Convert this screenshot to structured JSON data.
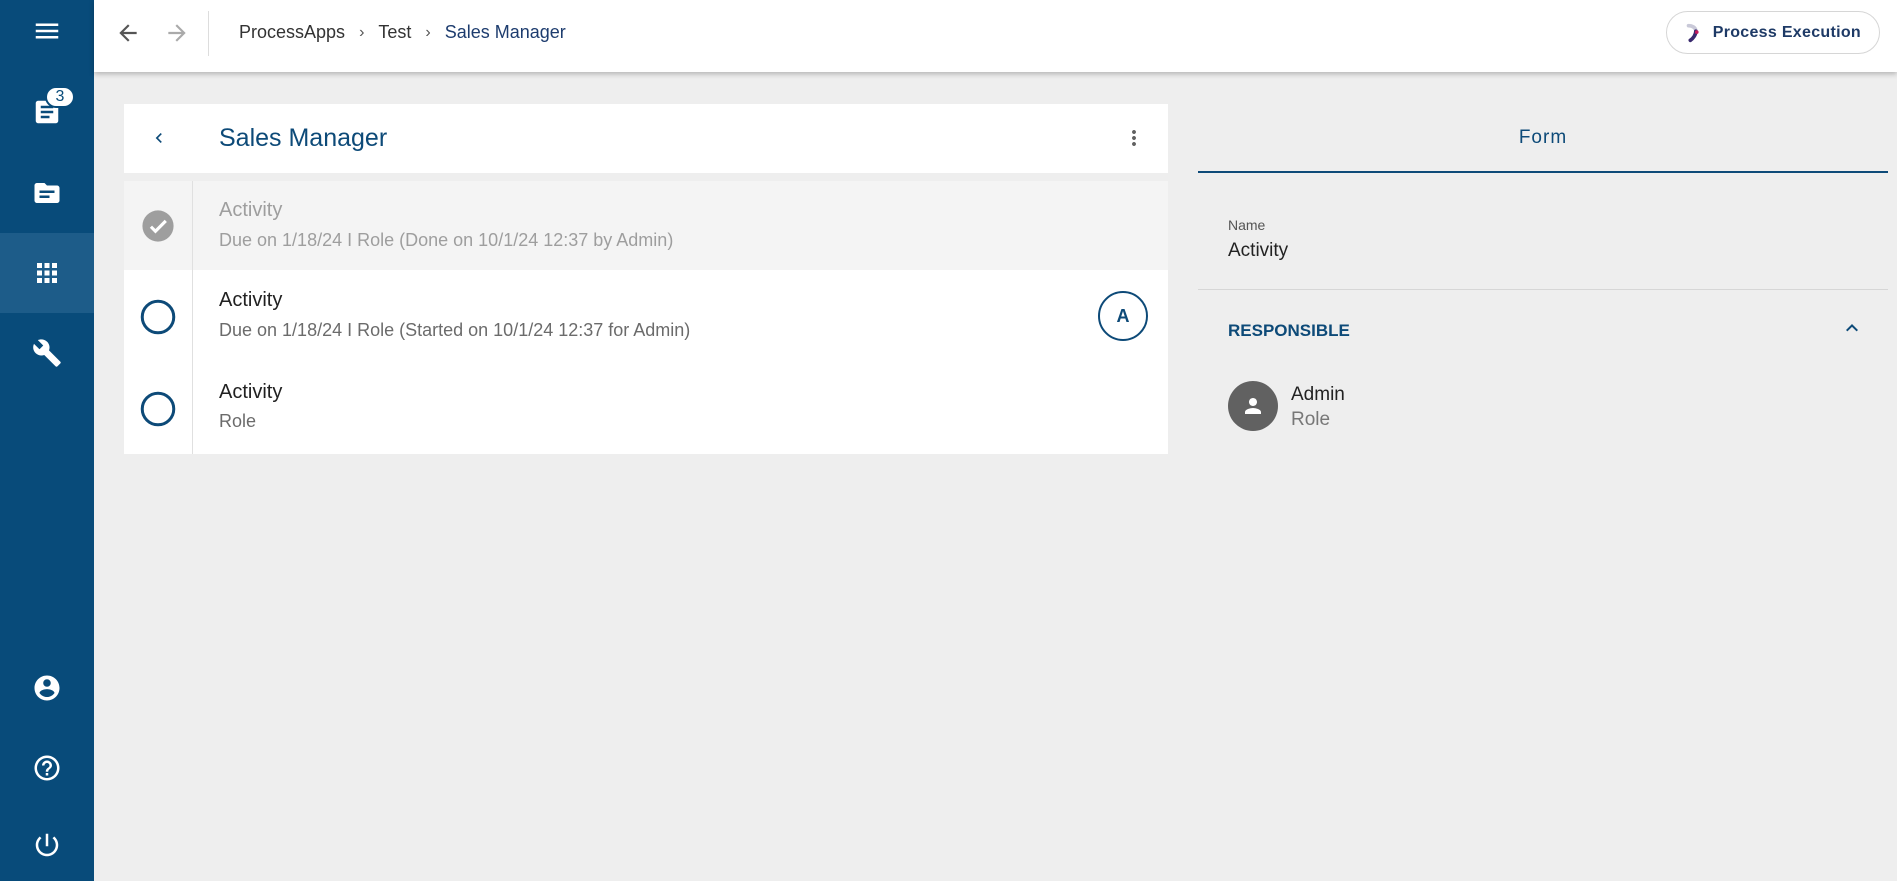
{
  "sidebar": {
    "notification_count": "3",
    "items": [
      {
        "icon": "menu-icon"
      },
      {
        "icon": "tasks-icon"
      },
      {
        "icon": "folder-icon"
      },
      {
        "icon": "apps-grid-icon",
        "active": true
      },
      {
        "icon": "wrench-icon"
      },
      {
        "icon": "account-icon"
      },
      {
        "icon": "help-icon"
      },
      {
        "icon": "power-icon"
      }
    ]
  },
  "topbar": {
    "breadcrumb": [
      "ProcessApps",
      "Test",
      "Sales Manager"
    ],
    "process_execution_label": "Process Execution"
  },
  "card": {
    "title": "Sales Manager",
    "activities": [
      {
        "title": "Activity",
        "subtitle": "Due on 1/18/24 I Role (Done on 10/1/24 12:37 by Admin)",
        "status": "done"
      },
      {
        "title": "Activity",
        "subtitle": "Due on 1/18/24 I Role (Started on 10/1/24 12:37 for Admin)",
        "status": "open",
        "assignee_initial": "A"
      },
      {
        "title": "Activity",
        "subtitle": "Role",
        "status": "open"
      }
    ]
  },
  "panel": {
    "tab_label": "Form",
    "name_label": "Name",
    "name_value": "Activity",
    "responsible_title": "RESPONSIBLE",
    "responsible": {
      "name": "Admin",
      "role": "Role"
    }
  },
  "colors": {
    "primary": "#084b7a",
    "accent_text": "#0d4a78",
    "background": "#eeeeee"
  }
}
